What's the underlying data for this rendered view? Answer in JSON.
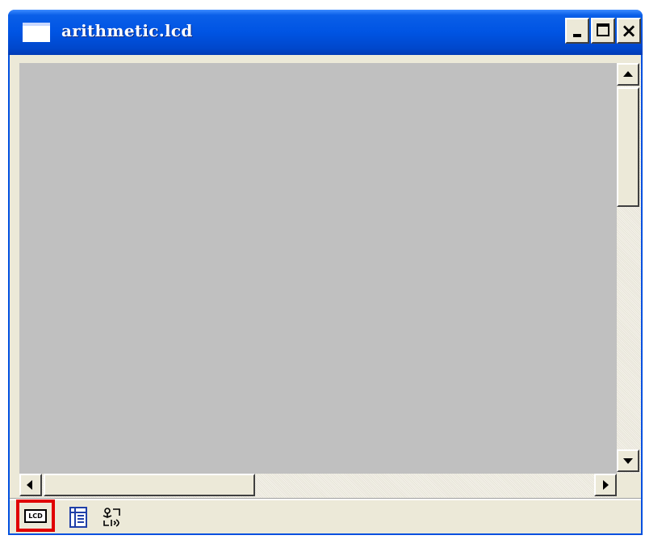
{
  "window": {
    "title": "arithmetic.lcd",
    "controls": {
      "minimize_icon": "minimize-icon",
      "maximize_icon": "maximize-icon",
      "close_icon": "close-icon",
      "close_glyph": "×"
    }
  },
  "client_area": {
    "background": "#c0c0c0"
  },
  "view_toolbar": {
    "buttons": [
      {
        "icon": "lcd-view-icon",
        "glyph": "LCD",
        "selected": true,
        "highlight_color": "#e00000"
      },
      {
        "icon": "list-view-icon",
        "glyph": "",
        "selected": false
      },
      {
        "icon": "io-view-icon",
        "glyph": "",
        "selected": false
      }
    ]
  },
  "colors": {
    "titlebar": "#0054e3",
    "window_face": "#ece9d8",
    "title_text": "#ffffff"
  }
}
